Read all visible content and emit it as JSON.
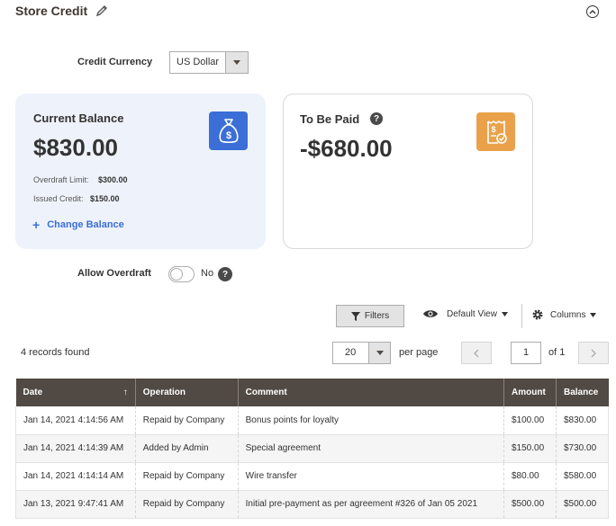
{
  "header": {
    "title": "Store Credit"
  },
  "currency": {
    "label": "Credit Currency",
    "value": "US Dollar"
  },
  "balance_card": {
    "title": "Current Balance",
    "amount": "$830.00",
    "overdraft_limit_label": "Overdraft Limit:",
    "overdraft_limit_value": "$300.00",
    "issued_credit_label": "Issued Credit:",
    "issued_credit_value": "$150.00",
    "change_link": "Change Balance",
    "icon_color": "#3b6ed6"
  },
  "paid_card": {
    "title": "To Be Paid",
    "amount": "-$680.00",
    "icon_color": "#e9a24a"
  },
  "overdraft": {
    "label": "Allow Overdraft",
    "state": "No",
    "enabled": false
  },
  "toolbar": {
    "filters_label": "Filters",
    "view_label": "Default View",
    "columns_label": "Columns"
  },
  "grid": {
    "records_found": "4 records found",
    "per_page_value": "20",
    "per_page_label": "per page",
    "page_current": "1",
    "page_of": "of 1",
    "columns": [
      "Date",
      "Operation",
      "Comment",
      "Amount",
      "Balance"
    ],
    "rows": [
      [
        "Jan 14, 2021 4:14:56 AM",
        "Repaid by Company",
        "Bonus points for loyalty",
        "$100.00",
        "$830.00"
      ],
      [
        "Jan 14, 2021 4:14:39 AM",
        "Added by Admin",
        "Special agreement",
        "$150.00",
        "$730.00"
      ],
      [
        "Jan 14, 2021 4:14:14 AM",
        "Repaid by Company",
        "Wire transfer",
        "$80.00",
        "$580.00"
      ],
      [
        "Jan 13, 2021 9:47:41 AM",
        "Repaid by Company",
        "Initial pre-payment as per agreement #326 of Jan 05 2021",
        "$500.00",
        "$500.00"
      ]
    ]
  }
}
